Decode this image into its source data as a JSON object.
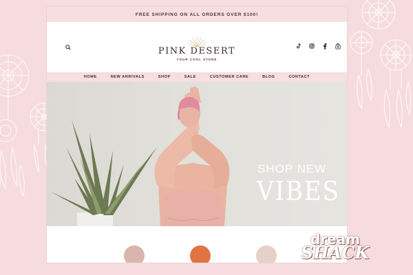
{
  "announcement": "FREE SHIPPING ON ALL ORDERS OVER $100!",
  "logo": {
    "name": "PINK DESERT",
    "tagline": "YOUR COOL STORE"
  },
  "nav": [
    "HOME",
    "NEW ARRIVALS",
    "SHOP",
    "SALE",
    "CUSTOMER CARE",
    "BLOG",
    "CONTACT"
  ],
  "hero": {
    "headline": "SHOP NEW",
    "subheadline": "VIBES"
  },
  "social_icons": [
    "tiktok-icon",
    "instagram-icon",
    "facebook-icon",
    "shop-icon"
  ],
  "brand_watermark": {
    "line1": "dream",
    "line2": "SHACK"
  },
  "colors": {
    "accent_pink": "#f6dfe0",
    "background": "#f6dcdf",
    "text_dark": "#3a2a2a"
  }
}
